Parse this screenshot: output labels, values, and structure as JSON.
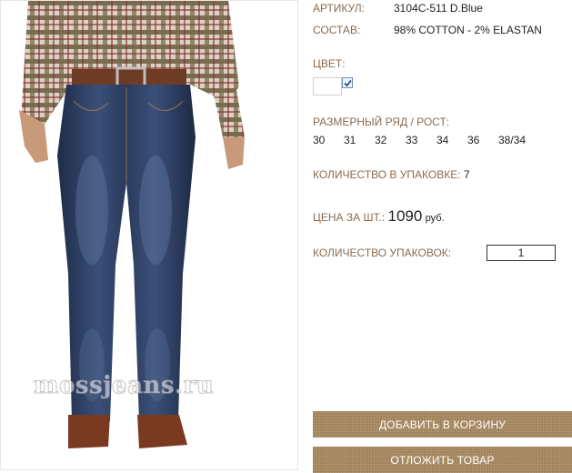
{
  "product": {
    "article_label": "АРТИКУЛ:",
    "article_value": "3104C-511 D.Blue",
    "composition_label": "СОСТАВ:",
    "composition_value": "98% COTTON - 2% ELASTAN",
    "color_label": "ЦВЕТ:",
    "color_swatch": "#ffffff",
    "color_checked": true,
    "size_label": "РАЗМЕРНЫЙ РЯД / РОСТ:",
    "sizes": [
      "30",
      "31",
      "32",
      "33",
      "34",
      "36",
      "38/34"
    ],
    "pack_qty_label": "КОЛИЧЕСТВО В УПАКОВКЕ:",
    "pack_qty_value": "7",
    "price_label": "ЦЕНА ЗА ШТ.:",
    "price_value": "1090",
    "price_currency": "руб.",
    "packs_label": "КОЛИЧЕСТВО УПАКОВОК:",
    "packs_value": "1"
  },
  "image": {
    "watermark": "mossjeans.ru"
  },
  "actions": {
    "add_to_cart": "ДОБАВИТЬ В КОРЗИНУ",
    "defer": "ОТЛОЖИТЬ ТОВАР"
  },
  "colors": {
    "label_brown": "#8b6a4e",
    "button_brown": "#a08058",
    "denim": "#2b3b5e"
  }
}
